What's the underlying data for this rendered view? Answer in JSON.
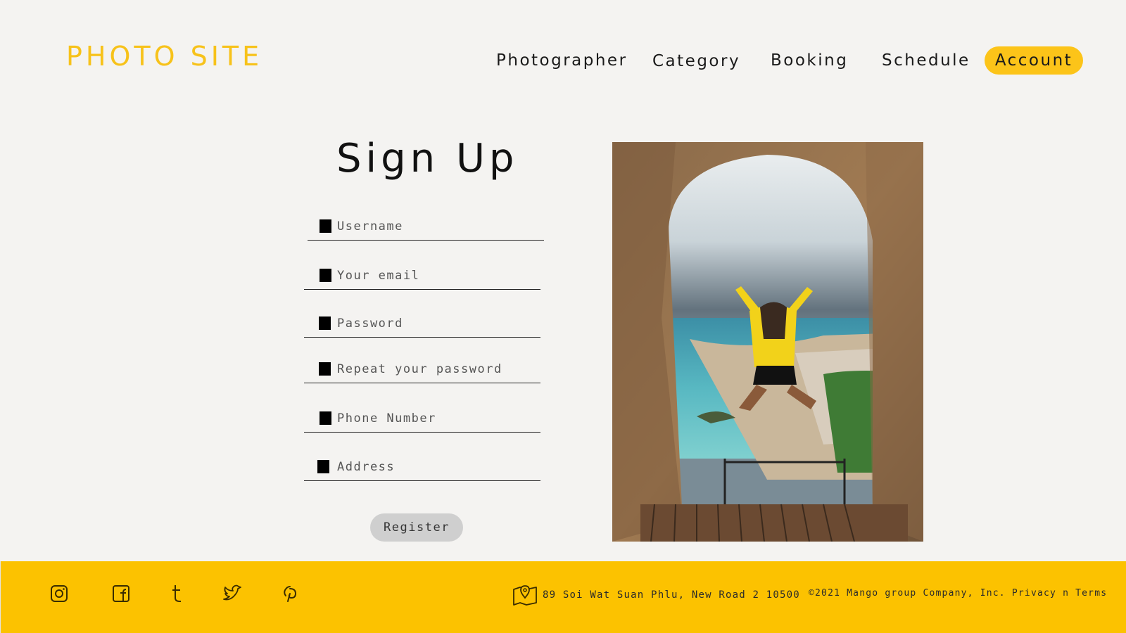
{
  "header": {
    "logo": "PHOTO SITE",
    "nav": [
      "Photographer",
      "Category",
      "Booking",
      "Schedule"
    ],
    "account_label": "Account"
  },
  "form": {
    "title": "Sign Up",
    "fields": [
      {
        "placeholder": "Username",
        "value": ""
      },
      {
        "placeholder": "Your email",
        "value": ""
      },
      {
        "placeholder": "Password",
        "value": ""
      },
      {
        "placeholder": "Repeat your password",
        "value": ""
      },
      {
        "placeholder": "Phone Number",
        "value": ""
      },
      {
        "placeholder": "Address",
        "value": ""
      }
    ],
    "register_label": "Register"
  },
  "footer": {
    "social_icons": [
      "instagram-icon",
      "facebook-icon",
      "tumblr-icon",
      "twitter-icon",
      "pinterest-icon"
    ],
    "address": "89 Soi Wat Suan Phlu, New Road 2 10500",
    "copyright": "©2021 Mango group Company, Inc.",
    "privacy_terms": "Privacy n Terms"
  },
  "colors": {
    "accent": "#fcc200",
    "logo": "#f7c21a",
    "background": "#f4f3f1",
    "register_button": "#cfcfcf"
  }
}
